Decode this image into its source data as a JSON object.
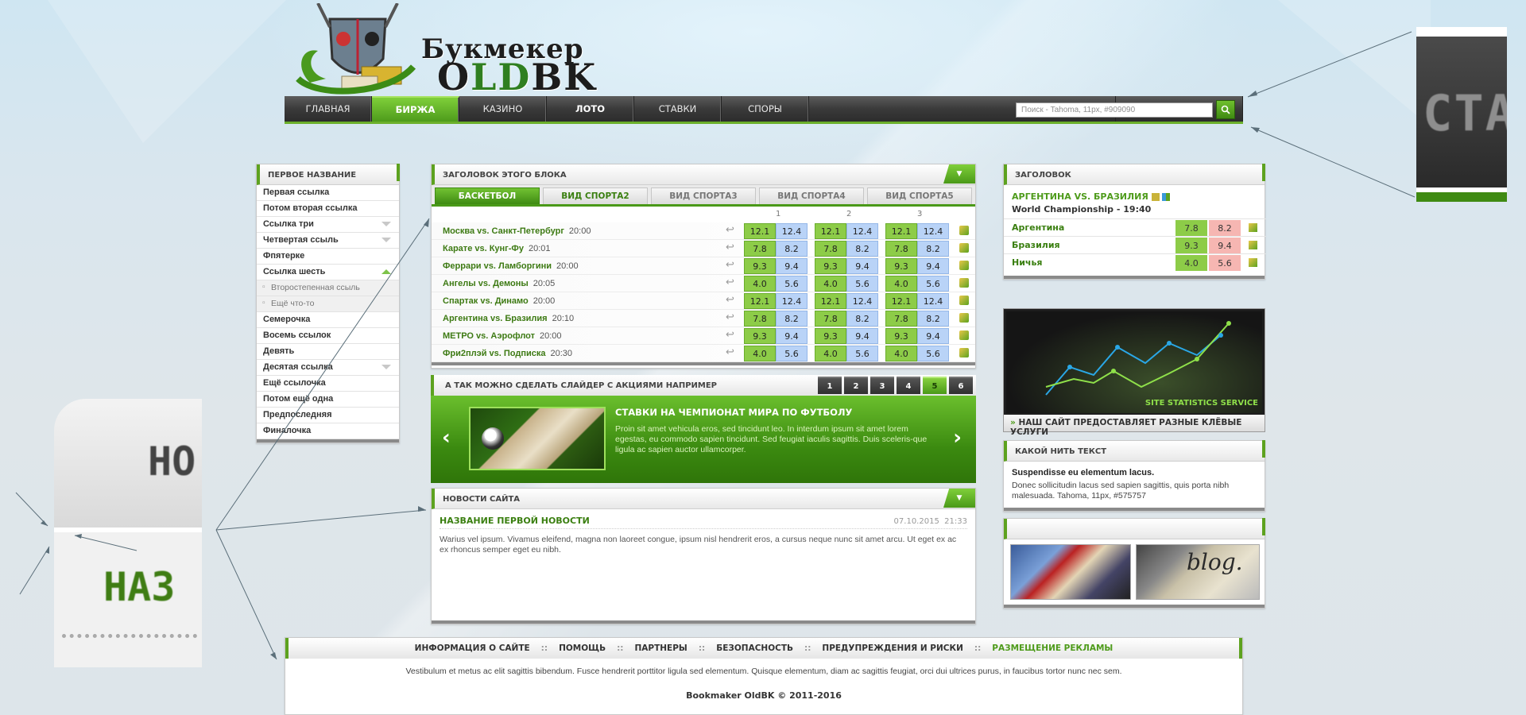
{
  "logo": {
    "line1": "Букмекер",
    "line2_prefix": "O",
    "line2_mid": "LD",
    "line2_suffix": "BK"
  },
  "nav": {
    "items": [
      {
        "label": "ГЛАВНАЯ",
        "state": "normal"
      },
      {
        "label": "БИРЖА",
        "state": "active"
      },
      {
        "label": "КАЗИНО",
        "state": "normal"
      },
      {
        "label": "ЛОТО",
        "state": "bold"
      },
      {
        "label": "СТАВКИ",
        "state": "normal"
      },
      {
        "label": "СПОРЫ",
        "state": "normal"
      }
    ],
    "search_placeholder": "Поиск - Tahoma, 11px, #909090"
  },
  "left_menu": {
    "title": "ПЕРВОЕ НАЗВАНИЕ",
    "items": [
      {
        "label": "Первая ссылка"
      },
      {
        "label": "Потом вторая ссылка"
      },
      {
        "label": "Ссылка три"
      },
      {
        "label": "Четвертая ссыль"
      },
      {
        "label": "Фпятерке"
      },
      {
        "label": "Ссылка шесть"
      },
      {
        "label": "Второстепенная ссыль"
      },
      {
        "label": "Ещё что-то"
      },
      {
        "label": "Семерочка"
      },
      {
        "label": "Восемь ссылок"
      },
      {
        "label": "Девять"
      },
      {
        "label": "Десятая ссылка"
      },
      {
        "label": "Ещё ссылочка"
      },
      {
        "label": "Потом ещё одна"
      },
      {
        "label": "Предпоследняя"
      },
      {
        "label": "Финалочка"
      }
    ]
  },
  "bets": {
    "title": "ЗАГОЛОВОК ЭТОГО БЛОКА",
    "tabs": [
      "БАСКЕТБОЛ",
      "ВИД СПОРТА2",
      "ВИД СПОРТА3",
      "ВИД СПОРТА4",
      "ВИД СПОРТА5"
    ],
    "columns": [
      "1",
      "2",
      "3"
    ],
    "rows": [
      {
        "match": "Москва vs. Санкт-Петербург",
        "time": "20:00",
        "odds": [
          "12.1",
          "12.4",
          "12.1",
          "12.4",
          "12.1",
          "12.4"
        ]
      },
      {
        "match": "Карате vs. Кунг-Фу",
        "time": "20:01",
        "odds": [
          "7.8",
          "8.2",
          "7.8",
          "8.2",
          "7.8",
          "8.2"
        ]
      },
      {
        "match": "Феррари vs. Ламборгини",
        "time": "20:00",
        "odds": [
          "9.3",
          "9.4",
          "9.3",
          "9.4",
          "9.3",
          "9.4"
        ]
      },
      {
        "match": "Ангелы vs. Демоны",
        "time": "20:05",
        "odds": [
          "4.0",
          "5.6",
          "4.0",
          "5.6",
          "4.0",
          "5.6"
        ]
      },
      {
        "match": "Спартак vs. Динамо",
        "time": "20:00",
        "odds": [
          "12.1",
          "12.4",
          "12.1",
          "12.4",
          "12.1",
          "12.4"
        ]
      },
      {
        "match": "Аргентина vs. Бразилия",
        "time": "20:10",
        "odds": [
          "7.8",
          "8.2",
          "7.8",
          "8.2",
          "7.8",
          "8.2"
        ]
      },
      {
        "match": "МЕТРО vs. Аэрофлот",
        "time": "20:00",
        "odds": [
          "9.3",
          "9.4",
          "9.3",
          "9.4",
          "9.3",
          "9.4"
        ]
      },
      {
        "match": "Фри2плэй vs. Подписка",
        "time": "20:30",
        "odds": [
          "4.0",
          "5.6",
          "4.0",
          "5.6",
          "4.0",
          "5.6"
        ]
      }
    ]
  },
  "slider": {
    "title": "А ТАК МОЖНО СДЕЛАТЬ СЛАЙДЕР С АКЦИЯМИ НАПРИМЕР",
    "pages": [
      "1",
      "2",
      "3",
      "4",
      "5",
      "6"
    ],
    "slide_title": "СТАВКИ НА ЧЕМПИОНАТ МИРА ПО ФУТБОЛУ",
    "slide_text": "Proin sit amet vehicula eros, sed tincidunt leo. In interdum ipsum sit amet lorem egestas, eu commodo sapien tincidunt. Sed feugiat iaculis sagittis. Duis sceleris-que ligula ac sapien auctor ullamcorper.",
    "prev": "‹",
    "next": "›"
  },
  "news": {
    "title": "НОВОСТИ САЙТА",
    "item_title": "НАЗВАНИЕ ПЕРВОЙ НОВОСТИ",
    "date": "07.10.2015",
    "time": "21:33",
    "text": "Warius vel ipsum. Vivamus eleifend, magna non laoreet congue, ipsum nisl hendrerit eros, a cursus neque nunc sit amet arcu. Ut eget ex ac ex rhoncus semper eget eu nibh."
  },
  "match": {
    "title": "ЗАГОЛОВОК",
    "match_name": "АРГЕНТИНА VS. БРАЗИЛИЯ",
    "subtitle": "World Championship - 19:40",
    "rows": [
      {
        "name": "Аргентина",
        "o1": "7.8",
        "o2": "8.2"
      },
      {
        "name": "Бразилия",
        "o1": "9.3",
        "o2": "9.4"
      },
      {
        "name": "Ничья",
        "o1": "4.0",
        "o2": "5.6"
      }
    ]
  },
  "stats": {
    "banner_text": "SITE STATISTICS SERVICE",
    "caption": "НАШ САЙТ ПРЕДОСТАВЛЯЕТ РАЗНЫЕ КЛЁВЫЕ УСЛУГИ"
  },
  "textbox": {
    "title": "КАКОЙ НИТЬ ТЕКСТ",
    "heading": "Suspendisse eu elementum lacus.",
    "text": "Donec sollicitudin lacus sed sapien sagittis, quis porta nibh malesuada. Tahoma, 11px, #575757"
  },
  "images": {
    "blog_text": "blog."
  },
  "footer": {
    "links": [
      "ИНФОРМАЦИЯ О САЙТЕ",
      "ПОМОЩЬ",
      "ПАРТНЕРЫ",
      "БЕЗОПАСНОСТЬ",
      "ПРЕДУПРЕЖДЕНИЯ И РИСКИ",
      "РАЗМЕЩЕНИЕ РЕКЛАМЫ"
    ],
    "separator": "::",
    "text": "Vestibulum et metus ac elit sagittis bibendum. Fusce hendrerit porttitor ligula sed elementum. Quisque elementum, diam ac sagittis feugiat, orci dui ultrices purus, in faucibus tortor nunc nec sem.",
    "copyright": "Bookmaker OldBK © 2011-2016"
  },
  "zoom": {
    "right_text": "CTA",
    "left_top_text": "HO",
    "left_bottom_text": "НАЗ"
  },
  "colors": {
    "accent": "#5da21f",
    "odds_green": "#8dcc48",
    "odds_blue": "#b9d3f7",
    "odds_red": "#f6b6b2",
    "link_green": "#3d7a13"
  }
}
